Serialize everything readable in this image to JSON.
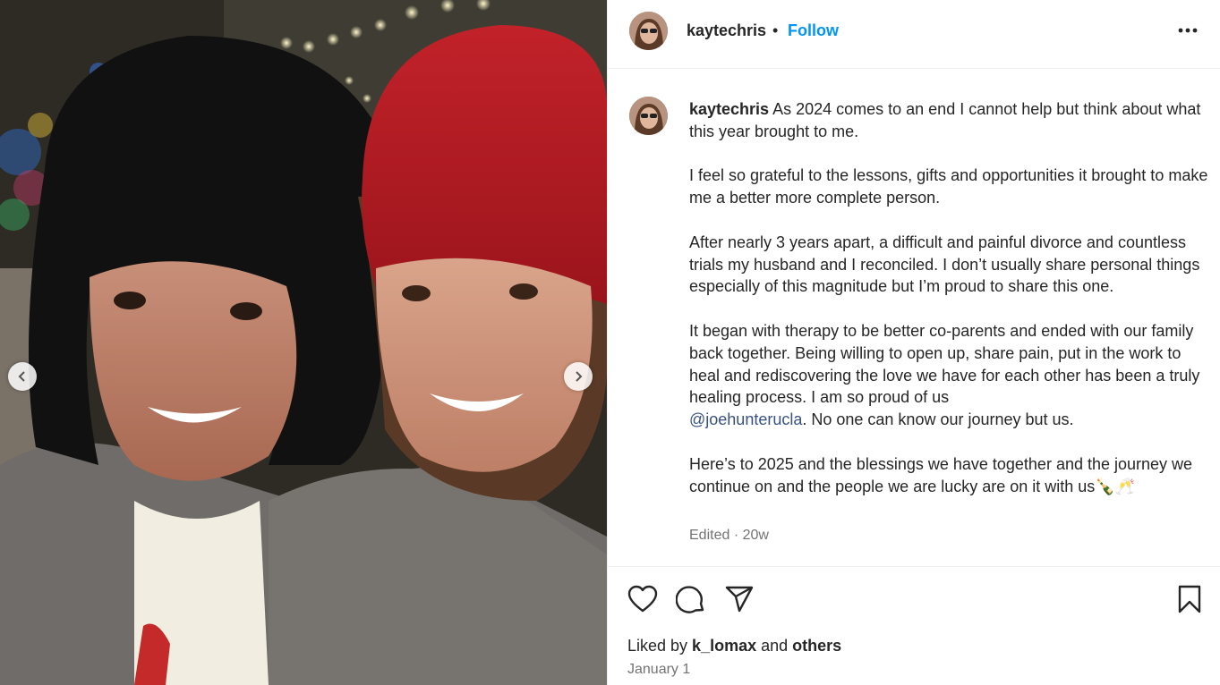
{
  "post": {
    "username": "kaytechris",
    "separator": "•",
    "follow_label": "Follow",
    "caption_intro": " As 2024 comes to an end I cannot help but think about what this year brought to me.\n\nI feel so grateful to the lessons, gifts and opportunities it brought to make me a better more complete person.\n\nAfter nearly 3 years apart, a difficult and painful divorce and countless trials my husband and I reconciled. I don’t usually share personal things especially of this magnitude but I’m proud to share this one.\n\nIt began with therapy to be better co-parents and ended with our family back together. Being willing to open up, share pain, put in the work to heal and rediscovering the love we have for each other has been a truly healing process. I am so proud of us\n",
    "mention": "@joehunterucla",
    "caption_outro": ". No one can know our journey but us.\n\nHere’s to 2025 and the blessings we have together and the journey we continue on and the people we are lucky are on it with us🍾🥂",
    "meta": "Edited · 20w",
    "liked_prefix": "Liked by ",
    "liked_user": "k_lomax",
    "liked_middle": " and ",
    "liked_others": "others",
    "date": "January 1"
  },
  "icons": {
    "more": "more-options-icon",
    "like": "heart-icon",
    "comment": "comment-icon",
    "share": "share-icon",
    "save": "bookmark-icon",
    "prev": "chevron-left-icon",
    "next": "chevron-right-icon"
  },
  "colors": {
    "accent": "#0095f6",
    "mention": "#385185",
    "secondary_text": "#737373",
    "divider": "#efefef"
  }
}
